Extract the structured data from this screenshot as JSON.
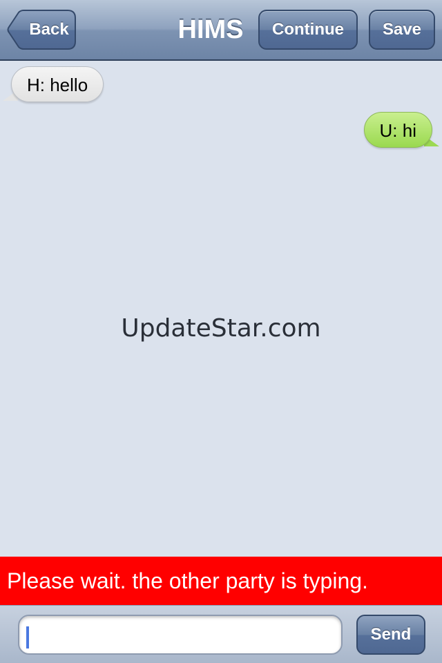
{
  "navbar": {
    "title": "HIMS",
    "back_label": "Back",
    "continue_label": "Continue",
    "save_label": "Save"
  },
  "messages": [
    {
      "direction": "incoming",
      "text": "H: hello"
    },
    {
      "direction": "outgoing",
      "text": "U: hi"
    }
  ],
  "watermark": "UpdateStar.com",
  "typing_banner": "Please wait. the other party is typing.",
  "composer": {
    "value": "",
    "placeholder": "",
    "send_label": "Send"
  },
  "colors": {
    "background": "#dbe2ed",
    "navbar": "#7d93b2",
    "incoming_bubble": "#e2e2e2",
    "outgoing_bubble": "#9ad94f",
    "banner": "#ff0000"
  }
}
